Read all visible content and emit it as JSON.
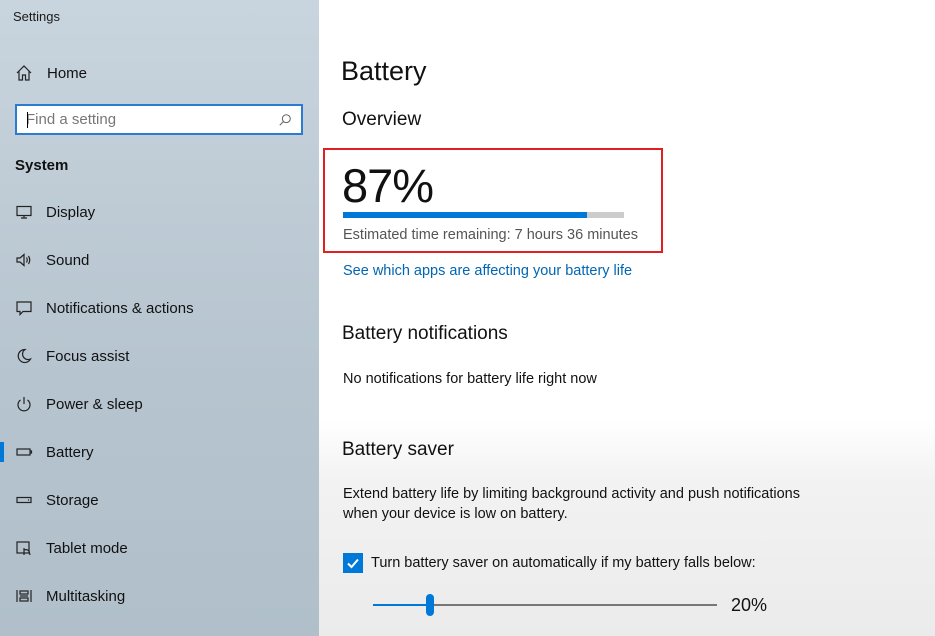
{
  "window": {
    "title": "Settings"
  },
  "sidebar": {
    "home_label": "Home",
    "search": {
      "placeholder": "Find a setting",
      "value": ""
    },
    "section_title": "System",
    "items": [
      {
        "label": "Display",
        "icon": "display-icon"
      },
      {
        "label": "Sound",
        "icon": "speaker-icon"
      },
      {
        "label": "Notifications & actions",
        "icon": "message-icon"
      },
      {
        "label": "Focus assist",
        "icon": "moon-icon"
      },
      {
        "label": "Power & sleep",
        "icon": "power-icon"
      },
      {
        "label": "Battery",
        "icon": "battery-icon",
        "active": true
      },
      {
        "label": "Storage",
        "icon": "storage-icon"
      },
      {
        "label": "Tablet mode",
        "icon": "tablet-icon"
      },
      {
        "label": "Multitasking",
        "icon": "multitasking-icon"
      }
    ]
  },
  "main": {
    "title": "Battery",
    "overview": {
      "heading": "Overview",
      "percent_text": "87%",
      "percent_value": 0.87,
      "estimate": "Estimated time remaining: 7 hours 36 minutes",
      "apps_link": "See which apps are affecting your battery life"
    },
    "notifications": {
      "heading": "Battery notifications",
      "text": "No notifications for battery life right now"
    },
    "saver": {
      "heading": "Battery saver",
      "description": "Extend battery life by limiting background activity and push notifications when your device is low on battery.",
      "auto_checkbox_label": "Turn battery saver on automatically if my battery falls below:",
      "auto_checked": true,
      "threshold_text": "20%",
      "threshold_value": 0.2
    }
  },
  "colors": {
    "accent": "#0078d7",
    "highlight_box": "#e02020",
    "link": "#0066b4"
  }
}
